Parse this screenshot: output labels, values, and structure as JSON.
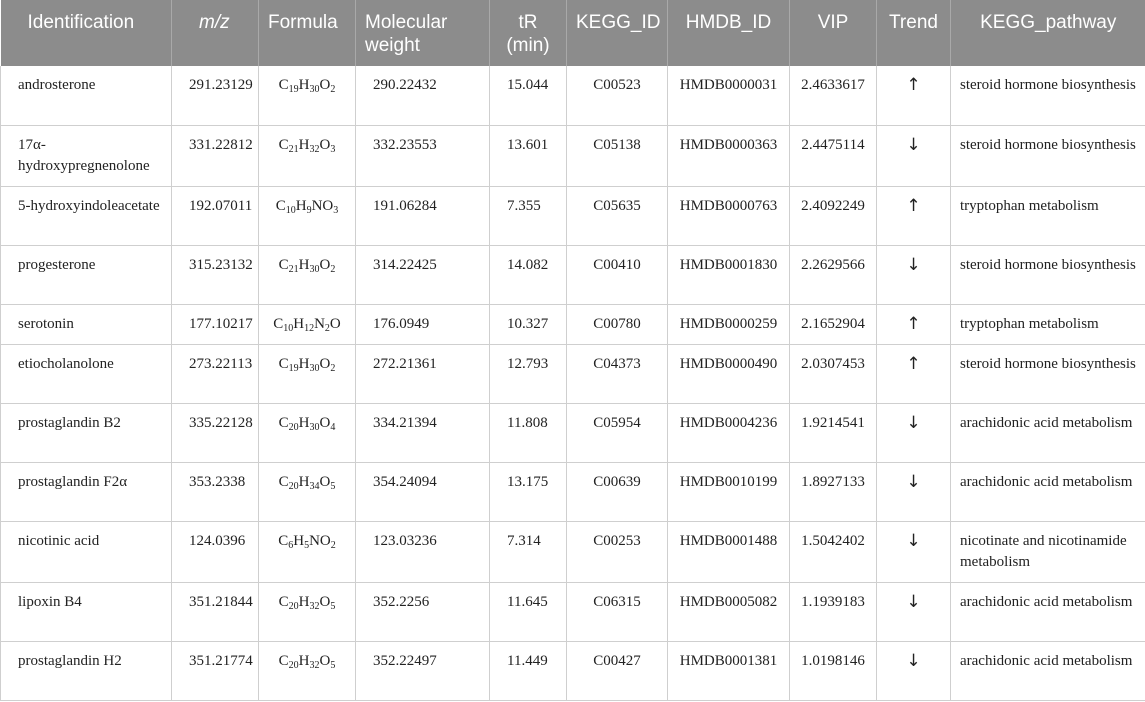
{
  "table": {
    "headers": {
      "identification": "Identification",
      "mz": "m/z",
      "formula": "Formula",
      "mw": "Molecular weight",
      "tr": "tR (min)",
      "kegg_id": "KEGG_ID",
      "hmdb_id": "HMDB_ID",
      "vip": "VIP",
      "trend": "Trend",
      "pathway": "KEGG_pathway"
    },
    "rows": [
      {
        "identification": "androsterone",
        "mz": "291.23129",
        "formula": [
          {
            "t": "C"
          },
          {
            "s": "19"
          },
          {
            "t": "H"
          },
          {
            "s": "30"
          },
          {
            "t": "O"
          },
          {
            "s": "2"
          }
        ],
        "mw": "290.22432",
        "tr": "15.044",
        "kegg_id": "C00523",
        "hmdb_id": "HMDB0000031",
        "vip": "2.4633617",
        "trend": "↑",
        "pathway": "steroid hormone biosynthesis"
      },
      {
        "identification": "17α-hydroxypregnenolone",
        "mz": "331.22812",
        "formula": [
          {
            "t": "C"
          },
          {
            "s": "21"
          },
          {
            "t": "H"
          },
          {
            "s": "32"
          },
          {
            "t": "O"
          },
          {
            "s": "3"
          }
        ],
        "mw": "332.23553",
        "tr": "13.601",
        "kegg_id": "C05138",
        "hmdb_id": "HMDB0000363",
        "vip": "2.4475114",
        "trend": "↓",
        "pathway": "steroid hormone biosynthesis"
      },
      {
        "identification": "5-hydroxyindoleacetate",
        "mz": "192.07011",
        "formula": [
          {
            "t": "C"
          },
          {
            "s": "10"
          },
          {
            "t": "H"
          },
          {
            "s": "9"
          },
          {
            "t": "NO"
          },
          {
            "s": "3"
          }
        ],
        "mw": "191.06284",
        "tr": "7.355",
        "kegg_id": "C05635",
        "hmdb_id": "HMDB0000763",
        "vip": "2.4092249",
        "trend": "↑",
        "pathway": "tryptophan metabolism"
      },
      {
        "identification": "progesterone",
        "mz": "315.23132",
        "formula": [
          {
            "t": "C"
          },
          {
            "s": "21"
          },
          {
            "t": "H"
          },
          {
            "s": "30"
          },
          {
            "t": "O"
          },
          {
            "s": "2"
          }
        ],
        "mw": "314.22425",
        "tr": "14.082",
        "kegg_id": "C00410",
        "hmdb_id": "HMDB0001830",
        "vip": "2.2629566",
        "trend": "↓",
        "pathway": "steroid hormone biosynthesis"
      },
      {
        "identification": "serotonin",
        "mz": "177.10217",
        "formula": [
          {
            "t": "C"
          },
          {
            "s": "10"
          },
          {
            "t": "H"
          },
          {
            "s": "12"
          },
          {
            "t": "N"
          },
          {
            "s": "2"
          },
          {
            "t": "O"
          }
        ],
        "mw": "176.0949",
        "tr": "10.327",
        "kegg_id": "C00780",
        "hmdb_id": "HMDB0000259",
        "vip": "2.1652904",
        "trend": "↑",
        "pathway": "tryptophan metabolism"
      },
      {
        "identification": "etiocholanolone",
        "mz": "273.22113",
        "formula": [
          {
            "t": "C"
          },
          {
            "s": "19"
          },
          {
            "t": "H"
          },
          {
            "s": "30"
          },
          {
            "t": "O"
          },
          {
            "s": "2"
          }
        ],
        "mw": "272.21361",
        "tr": "12.793",
        "kegg_id": "C04373",
        "hmdb_id": "HMDB0000490",
        "vip": "2.0307453",
        "trend": "↑",
        "pathway": "steroid hormone biosynthesis"
      },
      {
        "identification": "prostaglandin B2",
        "mz": "335.22128",
        "formula": [
          {
            "t": "C"
          },
          {
            "s": "20"
          },
          {
            "t": "H"
          },
          {
            "s": "30"
          },
          {
            "t": "O"
          },
          {
            "s": "4"
          }
        ],
        "mw": "334.21394",
        "tr": "11.808",
        "kegg_id": "C05954",
        "hmdb_id": "HMDB0004236",
        "vip": "1.9214541",
        "trend": "↓",
        "pathway": "arachidonic acid metabolism"
      },
      {
        "identification": "prostaglandin F2α",
        "mz": "353.2338",
        "formula": [
          {
            "t": "C"
          },
          {
            "s": "20"
          },
          {
            "t": "H"
          },
          {
            "s": "34"
          },
          {
            "t": "O"
          },
          {
            "s": "5"
          }
        ],
        "mw": "354.24094",
        "tr": "13.175",
        "kegg_id": "C00639",
        "hmdb_id": "HMDB0010199",
        "vip": "1.8927133",
        "trend": "↓",
        "pathway": "arachidonic acid metabolism"
      },
      {
        "identification": "nicotinic acid",
        "mz": "124.0396",
        "formula": [
          {
            "t": "C"
          },
          {
            "s": "6"
          },
          {
            "t": "H"
          },
          {
            "s": "5"
          },
          {
            "t": "NO"
          },
          {
            "s": "2"
          }
        ],
        "mw": "123.03236",
        "tr": "7.314",
        "kegg_id": "C00253",
        "hmdb_id": "HMDB0001488",
        "vip": "1.5042402",
        "trend": "↓",
        "pathway": "nicotinate and nicotinamide metabolism"
      },
      {
        "identification": "lipoxin B4",
        "mz": "351.21844",
        "formula": [
          {
            "t": "C"
          },
          {
            "s": "20"
          },
          {
            "t": "H"
          },
          {
            "s": "32"
          },
          {
            "t": "O"
          },
          {
            "s": "5"
          }
        ],
        "mw": "352.2256",
        "tr": "11.645",
        "kegg_id": "C06315",
        "hmdb_id": "HMDB0005082",
        "vip": "1.1939183",
        "trend": "↓",
        "pathway": "arachidonic acid metabolism"
      },
      {
        "identification": "prostaglandin H2",
        "mz": "351.21774",
        "formula": [
          {
            "t": "C"
          },
          {
            "s": "20"
          },
          {
            "t": "H"
          },
          {
            "s": "32"
          },
          {
            "t": "O"
          },
          {
            "s": "5"
          }
        ],
        "mw": "352.22497",
        "tr": "11.449",
        "kegg_id": "C00427",
        "hmdb_id": "HMDB0001381",
        "vip": "1.0198146",
        "trend": "↓",
        "pathway": "arachidonic acid metabolism"
      }
    ]
  }
}
